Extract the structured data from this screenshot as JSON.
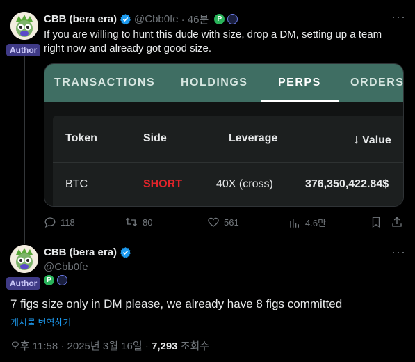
{
  "colors": {
    "background": "#000000",
    "accent": "#1d9bf0",
    "short": "#e0242a",
    "card_header": "#3f6e63",
    "author_badge": "#3f3a86"
  },
  "tweet1": {
    "name": "CBB (bera era)",
    "handle": "@Cbb0fe",
    "time": "· 46분",
    "author_badge": "Author",
    "text_line1": "If you are willing to hunt this dude with size, drop a DM, setting up a team",
    "text_line2": "right now and already got good size.",
    "more_icon": "more-dots-icon"
  },
  "card": {
    "tabs": [
      "TRANSACTIONS",
      "HOLDINGS",
      "PERPS",
      "ORDERS"
    ],
    "active_tab": "PERPS",
    "headers": {
      "token": "Token",
      "side": "Side",
      "leverage": "Leverage",
      "value_arrow": "↓",
      "value": "Value"
    },
    "row": {
      "token": "BTC",
      "side": "SHORT",
      "leverage": "40X (cross)",
      "value": "376,350,422.84$"
    }
  },
  "actions": {
    "replies": "118",
    "retweets": "80",
    "likes": "561",
    "views": "4.6만",
    "icons": [
      "reply-icon",
      "retweet-icon",
      "like-icon",
      "views-icon",
      "bookmark-icon",
      "share-icon"
    ]
  },
  "tweet2": {
    "name": "CBB (bera era)",
    "handle": "@Cbb0fe",
    "author_badge": "Author",
    "text": "7 figs size only in DM please, we already have 8 figs committed",
    "translate": "게시물 번역하기",
    "time": "오후 11:58 · 2025년 3월 16일 · ",
    "views_count": "7,293",
    "views_label": " 조회수"
  }
}
